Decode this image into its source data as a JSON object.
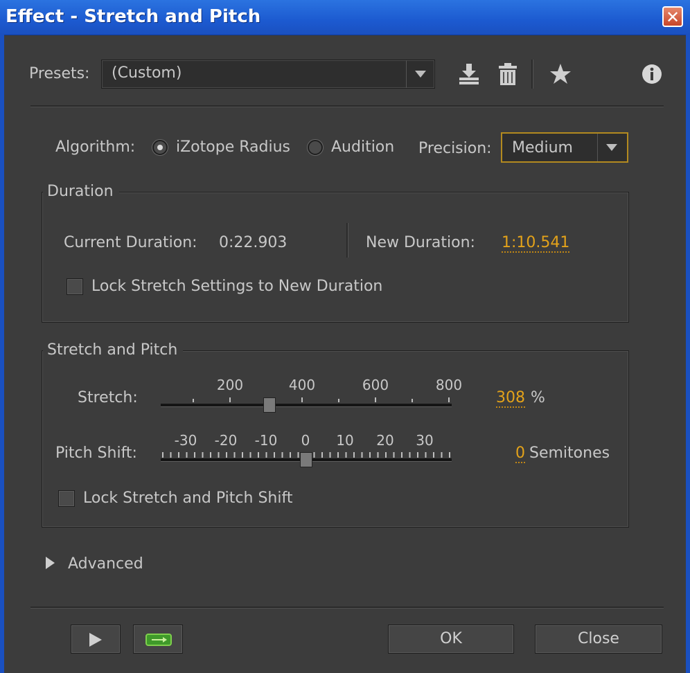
{
  "window": {
    "title": "Effect - Stretch and Pitch",
    "close_symbol": "✕"
  },
  "presets": {
    "label": "Presets:",
    "value": "(Custom)",
    "icons": [
      "save-preset-icon",
      "delete-preset-icon",
      "favorite-star-icon",
      "info-icon"
    ]
  },
  "algorithm": {
    "label": "Algorithm:",
    "options": [
      {
        "label": "iZotope Radius",
        "selected": true
      },
      {
        "label": "Audition",
        "selected": false
      }
    ]
  },
  "precision": {
    "label": "Precision:",
    "value": "Medium"
  },
  "duration": {
    "title": "Duration",
    "current_label": "Current Duration:",
    "current_value": "0:22.903",
    "new_label": "New Duration:",
    "new_value": "1:10.541",
    "lock_label": "Lock Stretch Settings to New Duration",
    "lock_checked": false
  },
  "stretch_pitch": {
    "title": "Stretch and Pitch",
    "stretch_label": "Stretch:",
    "stretch_ticks": [
      "200",
      "400",
      "600",
      "800"
    ],
    "stretch_value": "308",
    "stretch_unit": "%",
    "pitch_label": "Pitch Shift:",
    "pitch_ticks": [
      "-30",
      "-20",
      "-10",
      "0",
      "10",
      "20",
      "30"
    ],
    "pitch_value": "0",
    "pitch_unit": "Semitones",
    "lock_label": "Lock Stretch and Pitch Shift",
    "lock_checked": false
  },
  "advanced": {
    "label": "Advanced",
    "expanded": false
  },
  "footer": {
    "ok_label": "OK",
    "close_label": "Close"
  },
  "colors": {
    "accent": "#e3a21a",
    "title_bar": "#1c5ad0",
    "background": "#3c3c3c"
  }
}
